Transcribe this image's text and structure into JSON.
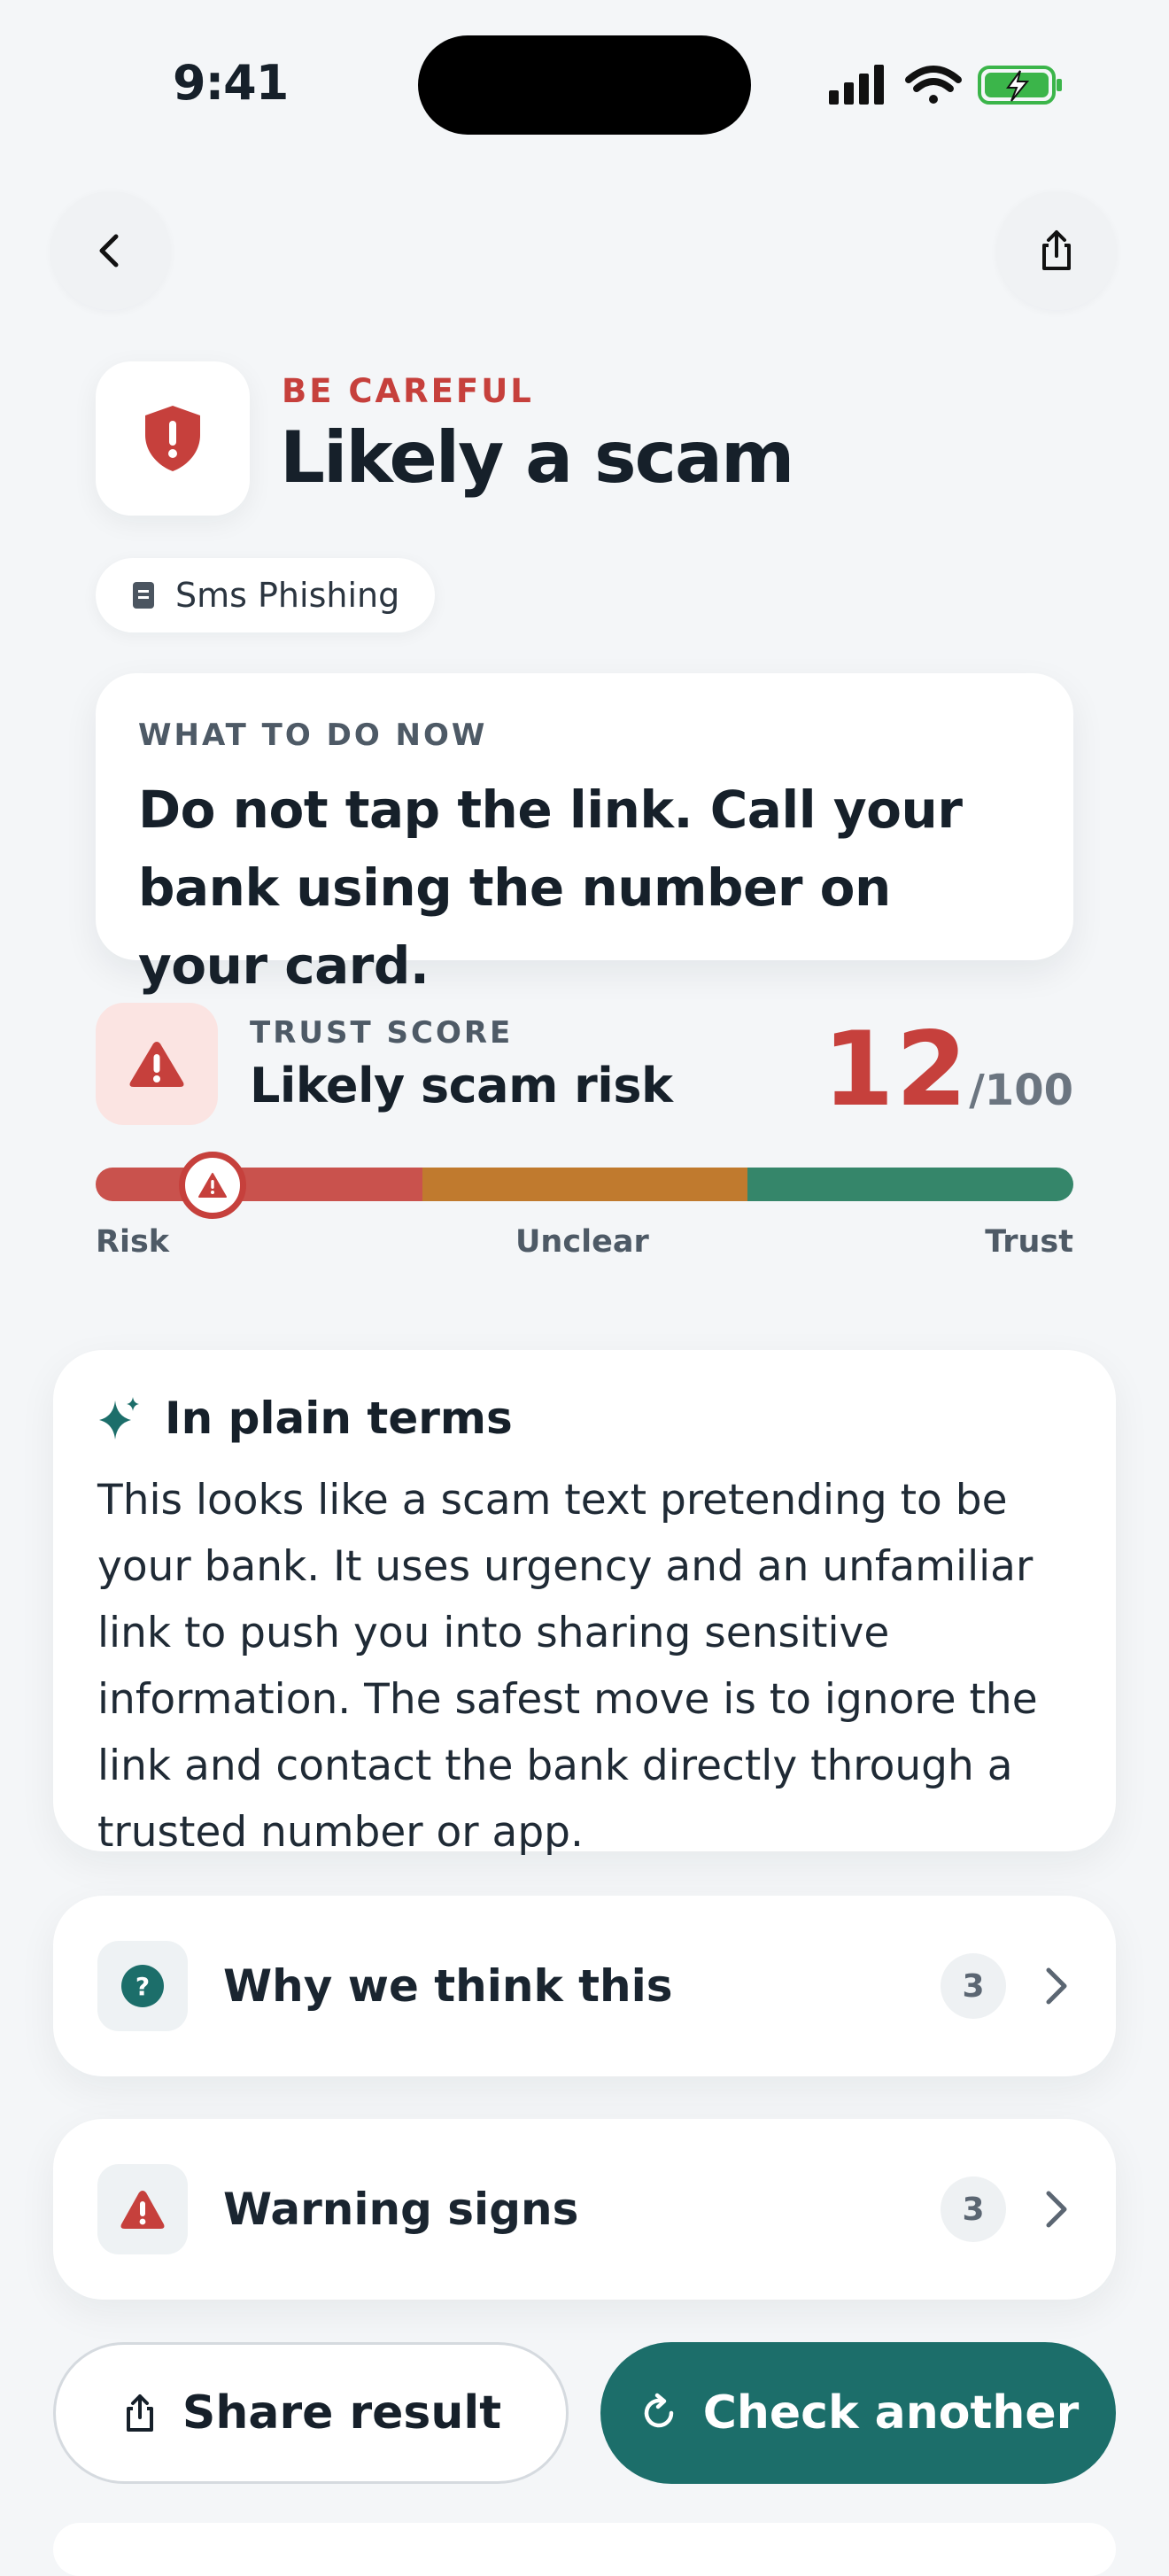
{
  "status_bar": {
    "time": "9:41"
  },
  "nav": {
    "back_icon": "chevron-left-icon",
    "share_icon": "share-icon"
  },
  "header": {
    "eyebrow": "BE CAREFUL",
    "title": "Likely a scam",
    "category_chip": "Sms Phishing",
    "accent_color": "#c6403c"
  },
  "what_to_do": {
    "label": "WHAT TO DO NOW",
    "text": "Do not tap the link. Call your bank using the number on your card."
  },
  "trust_score": {
    "label": "TRUST SCORE",
    "title": "Likely scam risk",
    "value": "12",
    "max": "/100",
    "scale_labels": [
      "Risk",
      "Unclear",
      "Trust"
    ],
    "marker_position_fraction": 0.12,
    "colors": {
      "risk": "#c9524d",
      "unclear": "#c07a2e",
      "trust": "#35866a"
    }
  },
  "plain_terms": {
    "title": "In plain terms",
    "body": "This looks like a scam text pretending to be your bank. It uses urgency and an unfamiliar link to push you into sharing sensitive information. The safest move is to ignore the link and contact the bank directly through a trusted number or app."
  },
  "sections": [
    {
      "label": "Why we think this",
      "count": "3",
      "icon": "question-icon"
    },
    {
      "label": "Warning signs",
      "count": "3",
      "icon": "warning-icon"
    }
  ],
  "actions": {
    "share_label": "Share result",
    "check_label": "Check another",
    "primary_color": "#1c6e6a"
  }
}
